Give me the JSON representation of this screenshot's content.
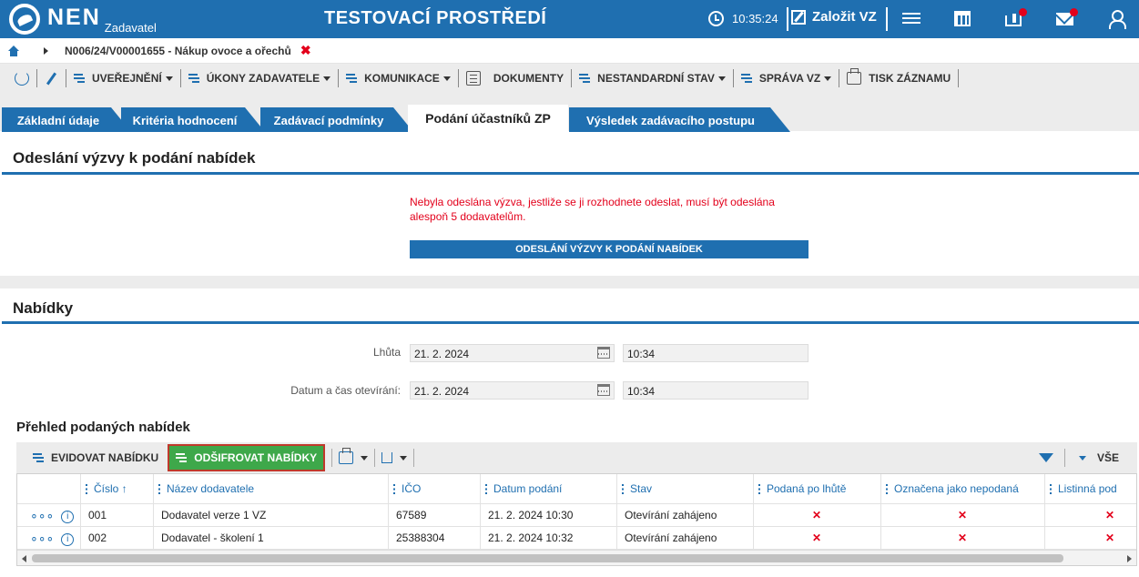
{
  "header": {
    "logo_text": "NEN",
    "logo_sub": "Zadavatel",
    "env_title": "TESTOVACÍ PROSTŘEDÍ",
    "time": "10:35:24",
    "create_label": "Založit VZ",
    "icons": [
      "clock-icon",
      "edit-icon",
      "menu-icon",
      "calendar-icon",
      "inbox-icon",
      "mail-icon",
      "user-icon"
    ]
  },
  "breadcrumb": {
    "text": "N006/24/V00001655 - Nákup ovoce a ořechů",
    "close": "✖"
  },
  "toolbar": {
    "items": [
      {
        "label": "UVEŘEJNĚNÍ"
      },
      {
        "label": "ÚKONY ZADAVATELE"
      },
      {
        "label": "KOMUNIKACE"
      },
      {
        "label": "DOKUMENTY"
      },
      {
        "label": "NESTANDARDNÍ STAV"
      },
      {
        "label": "SPRÁVA VZ"
      },
      {
        "label": "TISK ZÁZNAMU"
      }
    ]
  },
  "tabs": [
    {
      "label": "Základní údaje"
    },
    {
      "label": "Kritéria hodnocení"
    },
    {
      "label": "Zadávací podmínky"
    },
    {
      "label": "Podání účastníků ZP",
      "active": true
    },
    {
      "label": "Výsledek zadávacího postupu"
    }
  ],
  "sending": {
    "title": "Odeslání výzvy k podání nabídek",
    "warning": "Nebyla odeslána výzva, jestliže se ji rozhodnete odeslat, musí být odeslána alespoň 5 dodavatelům.",
    "button": "ODESLÁNÍ VÝZVY K PODÁNÍ NABÍDEK"
  },
  "offers": {
    "title": "Nabídky",
    "deadline_label": "Lhůta",
    "deadline_date": "21. 2. 2024",
    "deadline_time": "10:34",
    "opening_label": "Datum a čas otevírání:",
    "opening_date": "21. 2. 2024",
    "opening_time": "10:34",
    "overview_title": "Přehled podaných nabídek"
  },
  "grid_toolbar": {
    "evidovat": "EVIDOVAT NABÍDKU",
    "desifrovat": "ODŠIFROVAT NABÍDKY",
    "vse": "VŠE"
  },
  "table": {
    "columns": [
      "Číslo ↑",
      "Název dodavatele",
      "IČO",
      "Datum podání",
      "Stav",
      "Podaná po lhůtě",
      "Označena jako nepodaná",
      "Listinná pod"
    ],
    "rows": [
      {
        "cislo": "001",
        "nazev": "Dodavatel verze 1 VZ",
        "ico": "67589",
        "datum": "21. 2. 2024 10:30",
        "stav": "Otevírání zahájeno",
        "po_lhute": "✕",
        "nepodana": "✕",
        "listinna": "✕"
      },
      {
        "cislo": "002",
        "nazev": "Dodavatel - školení 1",
        "ico": "25388304",
        "datum": "21. 2. 2024 10:32",
        "stav": "Otevírání zahájeno",
        "po_lhute": "✕",
        "nepodana": "✕",
        "listinna": "✕"
      }
    ]
  },
  "colors": {
    "primary": "#1f6fb0",
    "danger": "#e3001b",
    "success": "#3ea84a"
  }
}
